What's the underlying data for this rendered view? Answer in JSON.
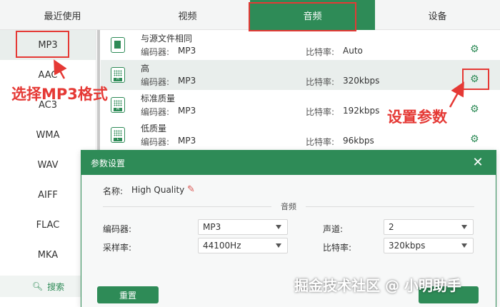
{
  "tabs": [
    {
      "label": "最近使用"
    },
    {
      "label": "视频"
    },
    {
      "label": "音频"
    },
    {
      "label": "设备"
    }
  ],
  "formats": [
    {
      "label": "MP3"
    },
    {
      "label": "AAC"
    },
    {
      "label": "AC3"
    },
    {
      "label": "WMA"
    },
    {
      "label": "WAV"
    },
    {
      "label": "AIFF"
    },
    {
      "label": "FLAC"
    },
    {
      "label": "MKA"
    }
  ],
  "search": {
    "label": "搜索"
  },
  "qualities": [
    {
      "name": "与源文件相同",
      "codec_label": "编码器:",
      "codec": "MP3",
      "bitrate_label": "比特率:",
      "bitrate": "Auto"
    },
    {
      "name": "高",
      "codec_label": "编码器:",
      "codec": "MP3",
      "bitrate_label": "比特率:",
      "bitrate": "320kbps"
    },
    {
      "name": "标准质量",
      "codec_label": "编码器:",
      "codec": "MP3",
      "bitrate_label": "比特率:",
      "bitrate": "192kbps"
    },
    {
      "name": "低质量",
      "codec_label": "编码器:",
      "codec": "MP3",
      "bitrate_label": "比特率:",
      "bitrate": "96kbps"
    }
  ],
  "dialog": {
    "title": "参数设置",
    "name_label": "名称:",
    "name_value": "High Quality",
    "section": "音频",
    "encoder_label": "编码器:",
    "encoder_value": "MP3",
    "channel_label": "声道:",
    "channel_value": "2",
    "samplerate_label": "采样率:",
    "samplerate_value": "44100Hz",
    "bitrate_label": "比特率:",
    "bitrate_value": "320kbps",
    "reset_label": "重置"
  },
  "annotations": {
    "choose_mp3": "选择MP3格式",
    "set_params": "设置参数"
  },
  "watermark": "掘金技术社区 @ 小明助手",
  "colors": {
    "accent": "#2e8b57",
    "annotation": "#e53935"
  }
}
